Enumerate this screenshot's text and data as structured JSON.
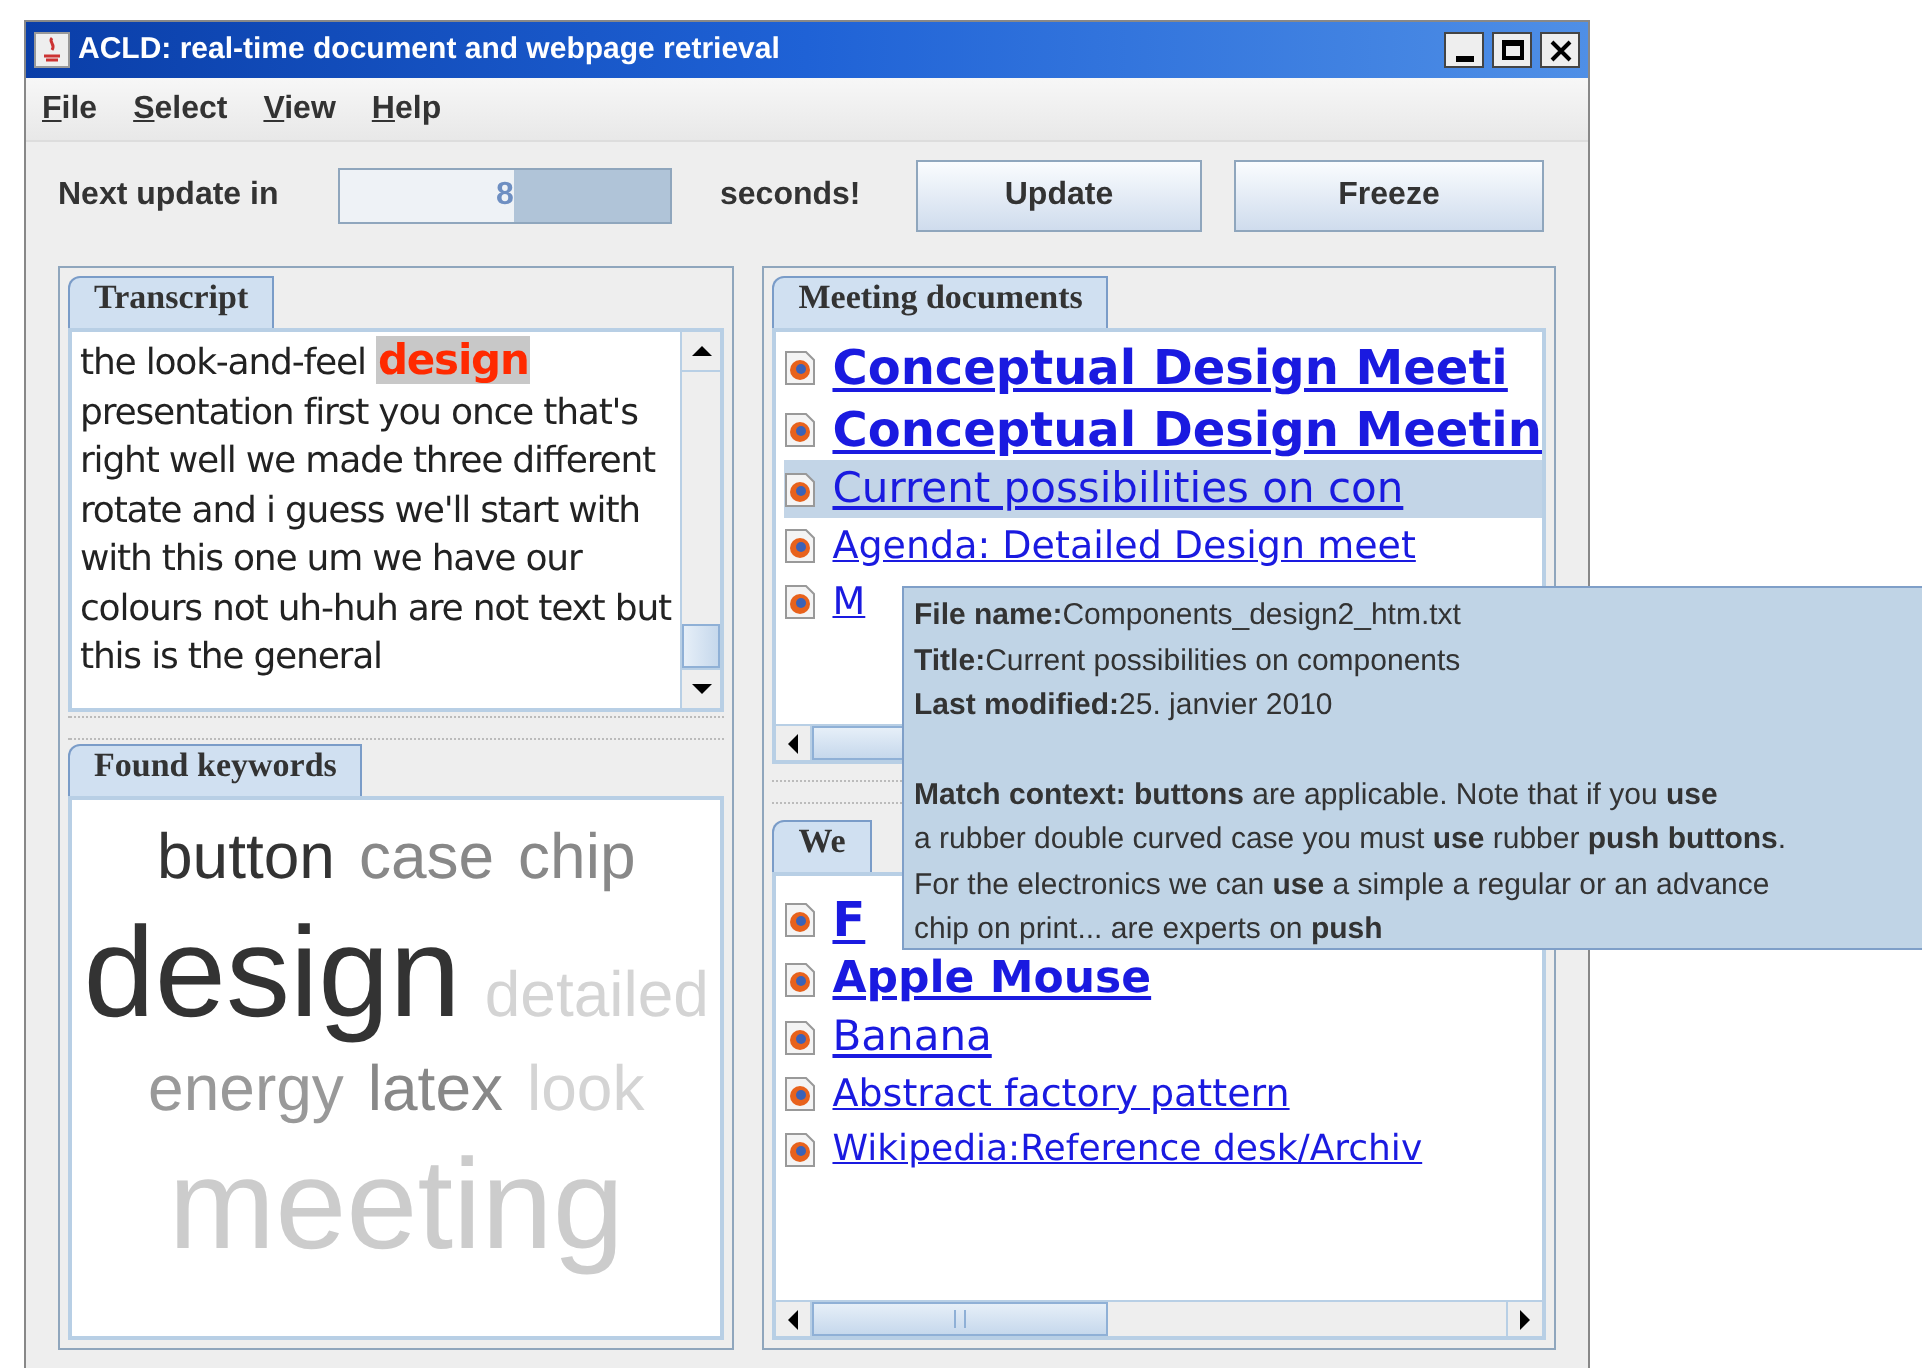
{
  "window": {
    "title": "ACLD: real-time document and webpage retrieval"
  },
  "menu": [
    "File",
    "Select",
    "View",
    "Help"
  ],
  "toolbar": {
    "prefix": "Next update in",
    "countdown": {
      "value": "8",
      "level": 0.47
    },
    "suffix": "seconds!",
    "buttons": [
      "Update",
      "Freeze"
    ]
  },
  "transcript": {
    "tab": "Transcript",
    "text": "the look-and-feel",
    "keyword": "design",
    "rest": "presentation first you once that's right well we made three different rotate and i guess we'll start with with this one um we have our colours not uh-huh are not text but this is the general"
  },
  "keywords": {
    "tab": "Found keywords",
    "rows": [
      [
        {
          "word": "button",
          "kind": "medium",
          "color": "#333333"
        },
        {
          "word": "case",
          "kind": "medium",
          "color": "#888888"
        },
        {
          "word": "chip",
          "kind": "medium",
          "color": "#888888"
        }
      ],
      [
        {
          "word": "design",
          "kind": "huge",
          "color": "#333333"
        },
        {
          "word": "detailed",
          "kind": "medium",
          "color": "#d4d4d4"
        }
      ],
      [
        {
          "word": "energy",
          "kind": "medium",
          "color": "#999999"
        },
        {
          "word": "latex",
          "kind": "medium",
          "color": "#888888"
        },
        {
          "word": "look",
          "kind": "medium",
          "color": "#d4d4d4"
        }
      ],
      [
        {
          "word": "meeting",
          "kind": "huge",
          "color": "#cccccc"
        }
      ]
    ]
  },
  "meeting_documents": {
    "tab": "Meeting documents",
    "items": [
      {
        "title": "Conceptual Design Meeti",
        "kind": "top",
        "selected": false
      },
      {
        "title": "Conceptual Design Meetin",
        "kind": "top",
        "selected": false
      },
      {
        "title": "Current possibilities on con",
        "kind": "mid",
        "selected": true
      },
      {
        "title": "Agenda: Detailed Design meet",
        "kind": "low",
        "selected": false
      },
      {
        "title": "M",
        "kind": "low",
        "selected": false
      }
    ]
  },
  "web_documents": {
    "tab": "We",
    "items": [
      {
        "title": "F",
        "kind": "top",
        "selected": false
      },
      {
        "title": "Apple Mouse ",
        "kind": "high",
        "selected": false
      },
      {
        "title": "Banana ",
        "kind": "mid",
        "selected": false
      },
      {
        "title": "Abstract factory pattern ",
        "kind": "low",
        "selected": false
      },
      {
        "title": "Wikipedia:Reference desk/Archiv",
        "kind": "least",
        "selected": false
      }
    ]
  },
  "tooltip": {
    "lines": [
      "**File name:**Components_design2_htm.txt",
      "**Title:**Current possibilities on components",
      "**Last modified:**25. janvier 2010"
    ],
    "match_context": [
      "**Match context: buttons** are applicable. Note that if you **use**",
      "a rubber double curved case you must **use** rubber **push buttons**.",
      "For the electronics we can **use** a simple a regular or an advance",
      "chip on print... are experts on **push**"
    ]
  }
}
